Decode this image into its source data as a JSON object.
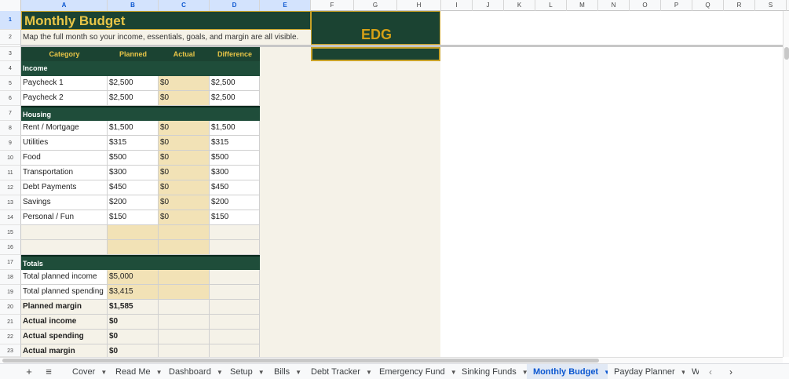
{
  "column_headers": [
    "A",
    "B",
    "C",
    "D",
    "E",
    "F",
    "G",
    "H",
    "I",
    "J",
    "K",
    "L",
    "M",
    "N",
    "O",
    "P",
    "Q",
    "R",
    "S"
  ],
  "row_numbers": [
    "1",
    "2",
    "3",
    "4",
    "5",
    "6",
    "7",
    "8",
    "9",
    "10",
    "11",
    "12",
    "13",
    "14",
    "15",
    "16",
    "17",
    "18",
    "19",
    "20",
    "21",
    "22",
    "23"
  ],
  "sheet": {
    "title": "Monthly Budget",
    "subtitle": "Map the full month so your income, essentials, goals, and margin are all visible.",
    "logo_text": "EDG",
    "headers": {
      "category": "Category",
      "planned": "Planned",
      "actual": "Actual",
      "difference": "Difference"
    },
    "income_section": "Income",
    "income_rows": [
      {
        "category": "Paycheck 1",
        "planned": "$2,500",
        "actual": "$0",
        "difference": "$2,500"
      },
      {
        "category": "Paycheck 2",
        "planned": "$2,500",
        "actual": "$0",
        "difference": "$2,500"
      }
    ],
    "housing_section": "Housing",
    "housing_rows": [
      {
        "category": "Rent / Mortgage",
        "planned": "$1,500",
        "actual": "$0",
        "difference": "$1,500"
      },
      {
        "category": "Utilities",
        "planned": "$315",
        "actual": "$0",
        "difference": "$315"
      },
      {
        "category": "Food",
        "planned": "$500",
        "actual": "$0",
        "difference": "$500"
      },
      {
        "category": "Transportation",
        "planned": "$300",
        "actual": "$0",
        "difference": "$300"
      },
      {
        "category": "Debt Payments",
        "planned": "$450",
        "actual": "$0",
        "difference": "$450"
      },
      {
        "category": "Savings",
        "planned": "$200",
        "actual": "$0",
        "difference": "$200"
      },
      {
        "category": "Personal / Fun",
        "planned": "$150",
        "actual": "$0",
        "difference": "$150"
      }
    ],
    "totals_section": "Totals",
    "totals": {
      "total_planned_income_label": "Total planned income",
      "total_planned_income": "$5,000",
      "total_planned_spending_label": "Total planned spending",
      "total_planned_spending": "$3,415",
      "planned_margin_label": "Planned margin",
      "planned_margin": "$1,585",
      "actual_income_label": "Actual income",
      "actual_income": "$0",
      "actual_spending_label": "Actual spending",
      "actual_spending": "$0",
      "actual_margin_label": "Actual margin",
      "actual_margin": "$0"
    }
  },
  "tabs": [
    {
      "label": "Cover"
    },
    {
      "label": "Read Me"
    },
    {
      "label": "Dashboard"
    },
    {
      "label": "Setup"
    },
    {
      "label": "Bills"
    },
    {
      "label": "Debt Tracker"
    },
    {
      "label": "Emergency Fund"
    },
    {
      "label": "Sinking Funds"
    },
    {
      "label": "Monthly Budget"
    },
    {
      "label": "Payday Planner"
    },
    {
      "label": "W"
    }
  ],
  "active_tab": "Monthly Budget",
  "tabbar": {
    "add_glyph": "+",
    "menu_glyph": "≡",
    "prev_glyph": "‹",
    "next_glyph": "›",
    "caret_glyph": "▼"
  },
  "colors": {
    "dark_green": "#1b4332",
    "gold": "#e8c547",
    "beige": "#f2e2b6",
    "cream": "#f5f2e8"
  }
}
